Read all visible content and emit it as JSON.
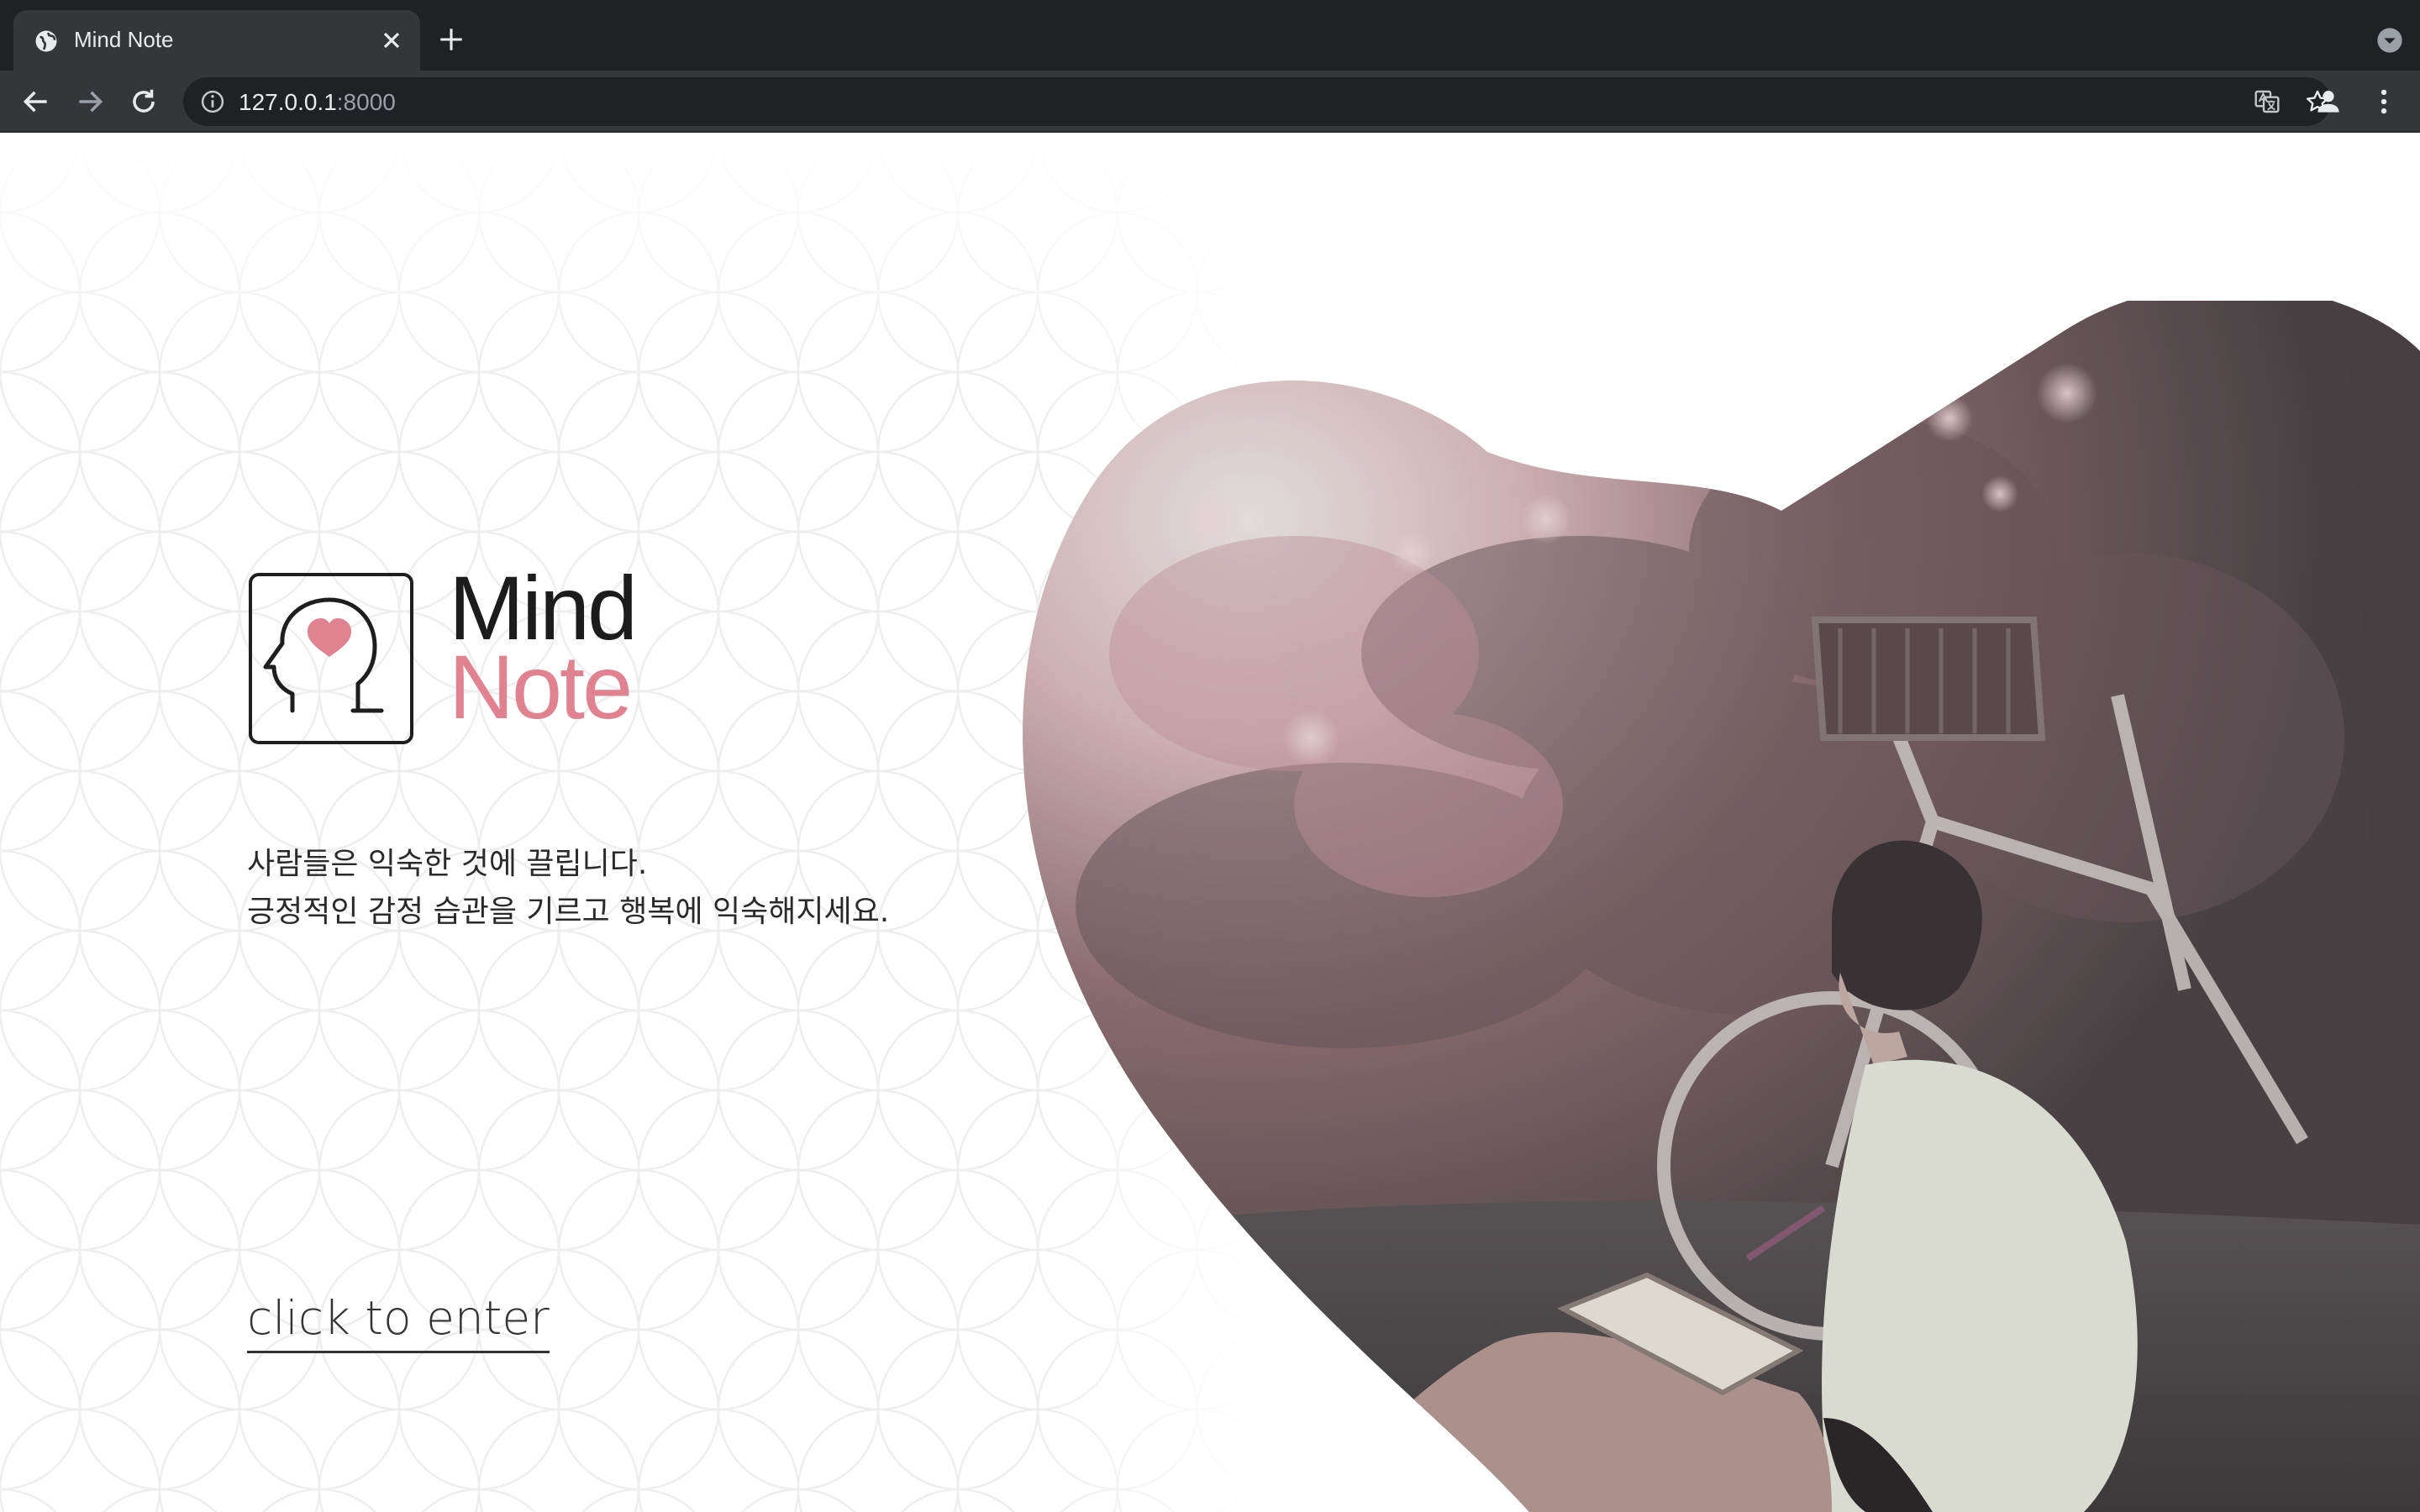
{
  "browser": {
    "tab": {
      "title": "Mind Note",
      "favicon": "globe-icon"
    },
    "address": {
      "host": "127.0.0.1",
      "port": ":8000"
    },
    "icons": [
      "back-arrow-icon",
      "forward-arrow-icon",
      "reload-icon",
      "info-icon",
      "translate-icon",
      "star-icon",
      "profile-icon",
      "more-vert-icon",
      "new-tab-icon",
      "tab-close-icon",
      "tab-search-icon"
    ],
    "colors": {
      "frame": "#202124",
      "toolbar": "#35363a",
      "text": "#e8eaed",
      "muted": "#9aa0a6"
    }
  },
  "page": {
    "brand": {
      "line1": "Mind",
      "line2": "Note",
      "accent": "#e0828f",
      "ink": "#1c1c1c"
    },
    "tagline": [
      "사람들은 익숙한 것에 끌립니다.",
      "긍정적인 감정 습관을 기르고 행복에 익숙해지세요."
    ],
    "cta": "click to enter",
    "hero": {
      "shape": "heart",
      "subject": "woman writing in notebook under tree beside bicycle"
    }
  }
}
